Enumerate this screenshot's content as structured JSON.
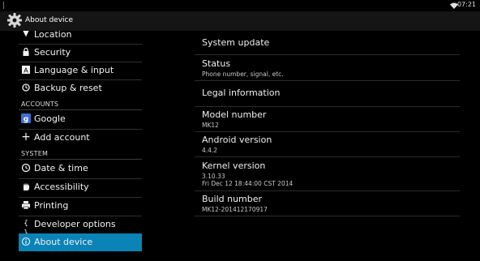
{
  "status_bar": {
    "time": "07:21",
    "icons": [
      "wifi-icon"
    ]
  },
  "action_bar": {
    "title": "About device",
    "icon": "settings-gear-icon"
  },
  "sidebar": {
    "items": [
      {
        "label": "Location",
        "icon": "location-pin-icon"
      },
      {
        "label": "Security",
        "icon": "lock-icon"
      },
      {
        "label": "Language & input",
        "icon": "keyboard-icon"
      },
      {
        "label": "Backup & reset",
        "icon": "backup-reset-icon"
      }
    ],
    "accounts_header": "ACCOUNTS",
    "accounts": [
      {
        "label": "Google",
        "icon": "google-icon"
      },
      {
        "label": "Add account",
        "icon": "plus-icon"
      }
    ],
    "system_header": "SYSTEM",
    "system": [
      {
        "label": "Date & time",
        "icon": "clock-icon"
      },
      {
        "label": "Accessibility",
        "icon": "hand-icon"
      },
      {
        "label": "Printing",
        "icon": "printer-icon"
      },
      {
        "label": "Developer options",
        "icon": "braces-icon"
      },
      {
        "label": "About device",
        "icon": "info-icon",
        "selected": true
      }
    ],
    "selected_color": "#0a83b6"
  },
  "main": {
    "items": [
      {
        "title": "System update"
      },
      {
        "title": "Status",
        "subtitle": "Phone number, signal, etc."
      },
      {
        "title": "Legal information"
      },
      {
        "title": "Model number",
        "subtitle": "MK12"
      },
      {
        "title": "Android version",
        "subtitle": "4.4.2"
      },
      {
        "title": "Kernel version",
        "subtitle": "3.10.33",
        "subtitle2": "Fri Dec 12 18:44:00 CST 2014"
      },
      {
        "title": "Build number",
        "subtitle": "MK12-201412170917"
      }
    ]
  }
}
